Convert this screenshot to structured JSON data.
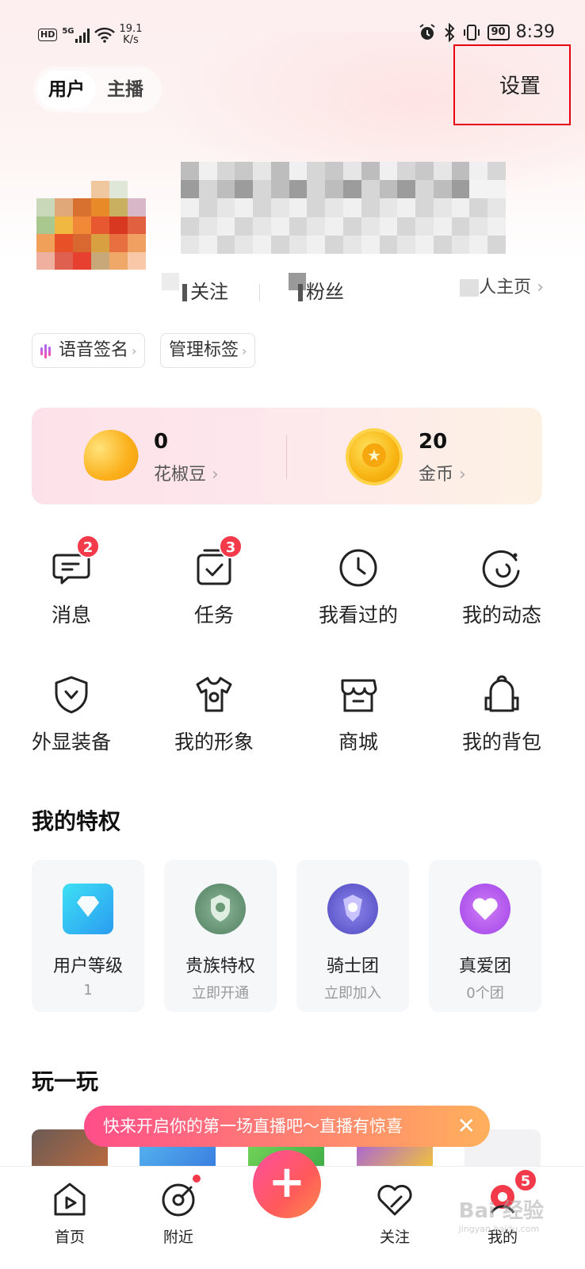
{
  "status_bar": {
    "hd": "HD",
    "signal": "5G",
    "net_speed": "19.1",
    "net_unit": "K/s",
    "battery": "90",
    "time": "8:39"
  },
  "header": {
    "role_tabs": [
      "用户",
      "主播"
    ],
    "active_role": "用户",
    "settings_label": "设置"
  },
  "profile": {
    "following_label": "关注",
    "fans_label": "粉丝",
    "homepage_link": "人主页"
  },
  "chips": {
    "voice_signature": "语音签名",
    "manage_tags": "管理标签"
  },
  "wallet": {
    "beans": {
      "value": "0",
      "label": "花椒豆"
    },
    "coins": {
      "value": "20",
      "label": "金币"
    }
  },
  "grid": {
    "row1": [
      {
        "label": "消息",
        "badge": "2"
      },
      {
        "label": "任务",
        "badge": "3"
      },
      {
        "label": "我看过的"
      },
      {
        "label": "我的动态"
      }
    ],
    "row2": [
      {
        "label": "外显装备"
      },
      {
        "label": "我的形象"
      },
      {
        "label": "商城"
      },
      {
        "label": "我的背包"
      }
    ]
  },
  "privileges": {
    "title": "我的特权",
    "items": [
      {
        "title": "用户等级",
        "sub": "1"
      },
      {
        "title": "贵族特权",
        "sub": "立即开通"
      },
      {
        "title": "骑士团",
        "sub": "立即加入"
      },
      {
        "title": "真爱团",
        "sub": "0个团"
      }
    ]
  },
  "play": {
    "title": "玩一玩"
  },
  "toast": {
    "text": "快来开启你的第一场直播吧～直播有惊喜",
    "close": "✕"
  },
  "tabbar": {
    "home": "首页",
    "nearby": "附近",
    "plus": "+",
    "follow": "关注",
    "mine": "我的",
    "mine_badge": "5"
  },
  "watermark": {
    "text": "Bai 经验",
    "sub": "jingyan.baidu.com"
  },
  "colors": {
    "accent_red": "#f23a4a",
    "highlight_box": "#e60012"
  }
}
